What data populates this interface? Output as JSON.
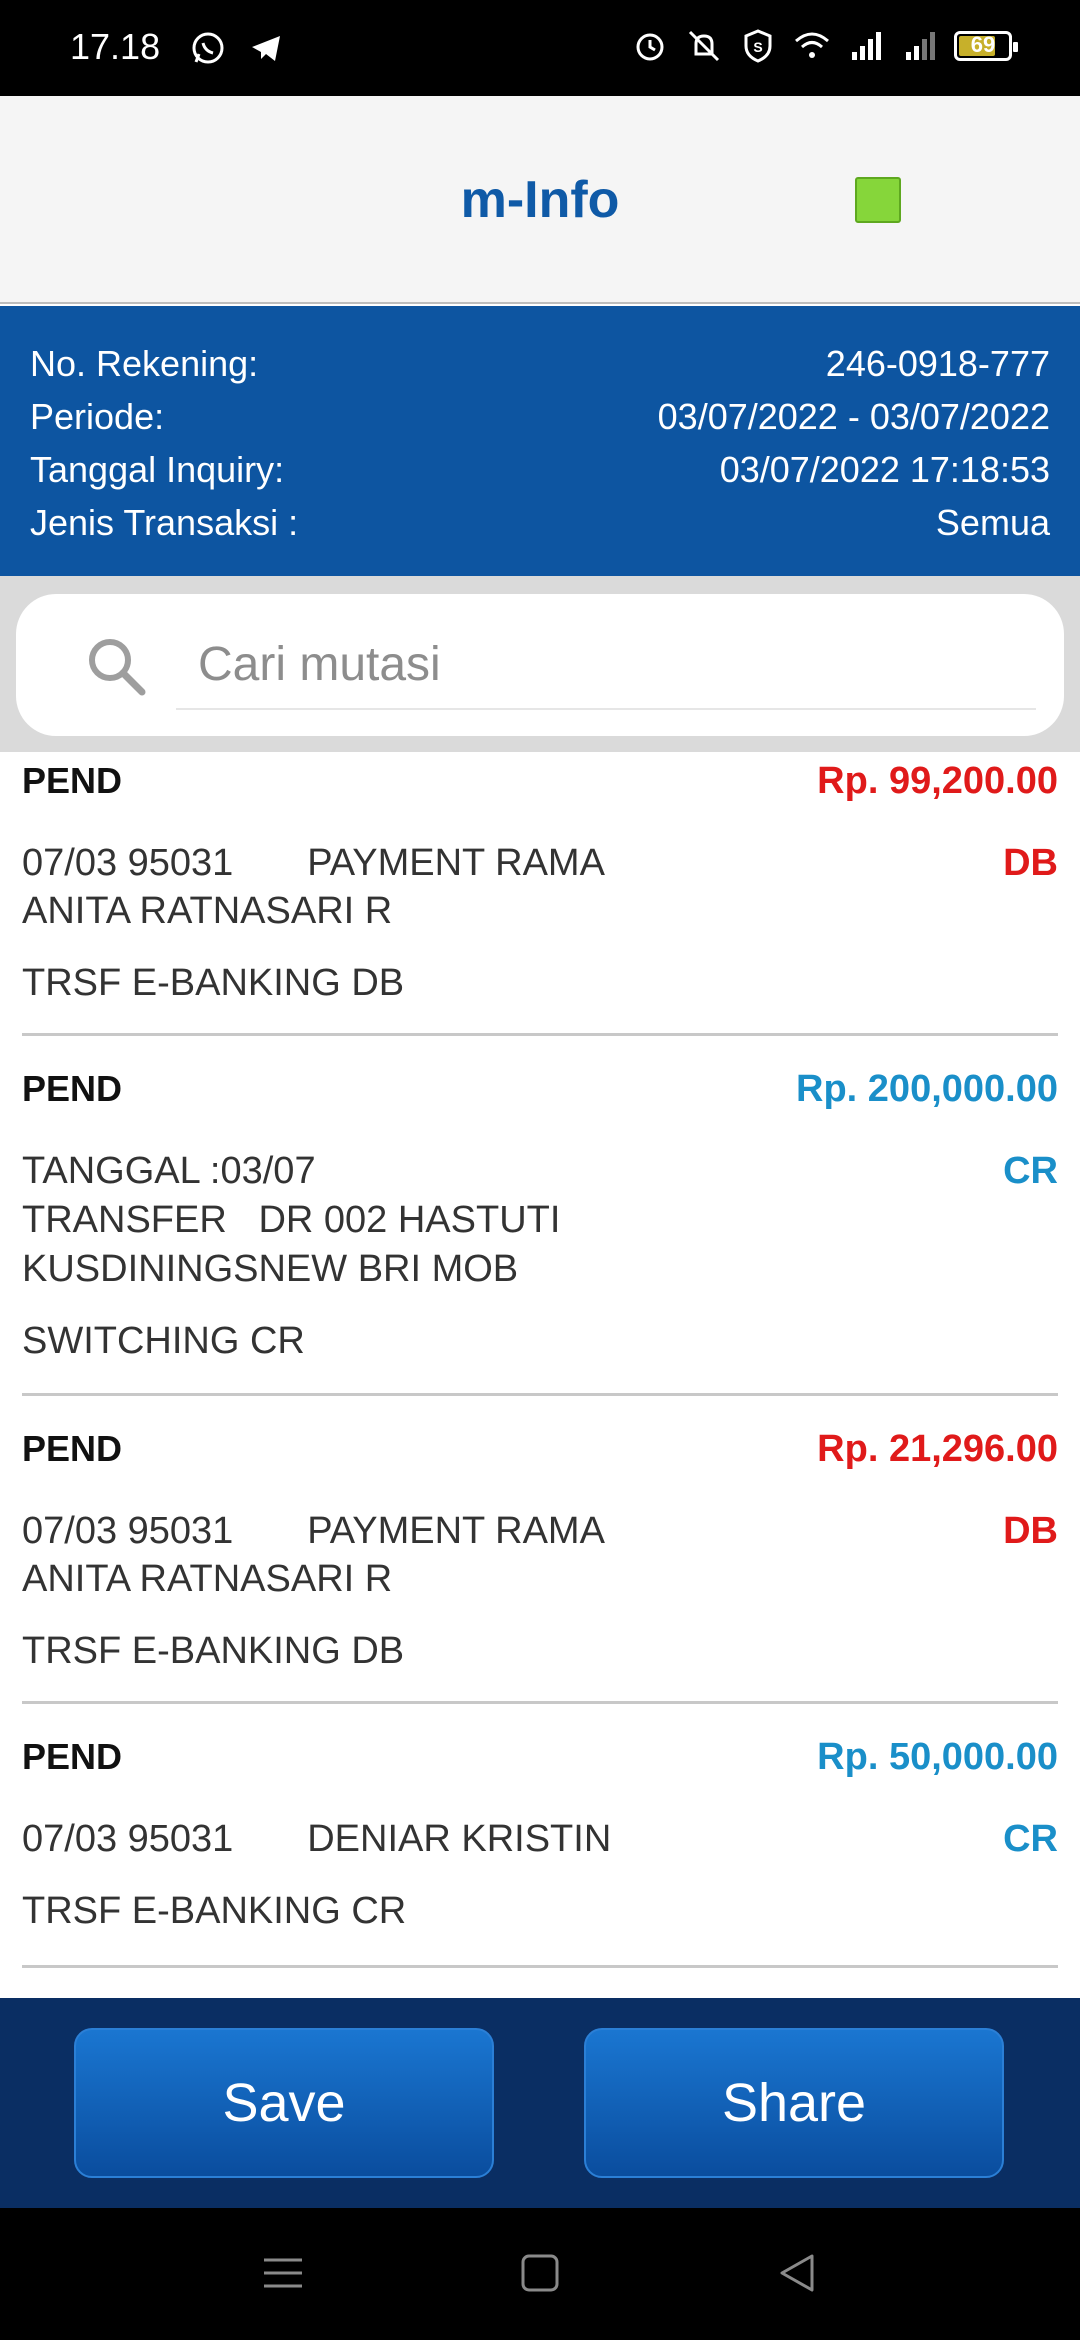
{
  "status_bar": {
    "time": "17.18",
    "left_icons": [
      "whatsapp-icon",
      "telegram-icon"
    ],
    "right_icons": [
      "alarm-icon",
      "mute-icon",
      "shield-icon",
      "wifi-icon",
      "signal-icon",
      "signal-icon-2"
    ],
    "battery": "69",
    "battery_level": 0.69
  },
  "app_bar": {
    "title": "m-Info",
    "accent_color": "#86d63a"
  },
  "info": {
    "account_label": "No. Rekening:",
    "account_value": "246-0918-777",
    "period_label": "Periode:",
    "period_value": "03/07/2022 - 03/07/2022",
    "inquiry_label": "Tanggal Inquiry:",
    "inquiry_value": "03/07/2022 17:18:53",
    "type_label": "Jenis Transaksi :",
    "type_value": "Semua"
  },
  "search": {
    "placeholder": "Cari mutasi",
    "icon": "search-icon"
  },
  "transactions": [
    {
      "status": "PEND",
      "amount": "Rp. 99,200.00",
      "type": "DB",
      "lines": [
        "07/03 95031       PAYMENT RAMA",
        "ANITA RATNASARI R",
        "TRSF E-BANKING DB"
      ]
    },
    {
      "status": "PEND",
      "amount": "Rp. 200,000.00",
      "type": "CR",
      "lines": [
        "TANGGAL :03/07",
        "TRANSFER   DR 002 HASTUTI",
        "KUSDININGSNEW BRI MOB",
        "SWITCHING CR"
      ]
    },
    {
      "status": "PEND",
      "amount": "Rp. 21,296.00",
      "type": "DB",
      "lines": [
        "07/03 95031       PAYMENT RAMA",
        "ANITA RATNASARI R",
        "TRSF E-BANKING DB"
      ]
    },
    {
      "status": "PEND",
      "amount": "Rp. 50,000.00",
      "type": "CR",
      "lines": [
        "07/03 95031       DENIAR KRISTIN",
        "TRSF E-BANKING CR"
      ]
    }
  ],
  "buttons": {
    "save_label": "Save",
    "share_label": "Share"
  },
  "nav": {
    "icons": [
      "menu-icon",
      "home-square-icon",
      "back-triangle-icon"
    ]
  },
  "colors": {
    "primary_blue": "#0d55a1",
    "debit_red": "#e01a1a",
    "credit_blue": "#1a8fc9"
  }
}
